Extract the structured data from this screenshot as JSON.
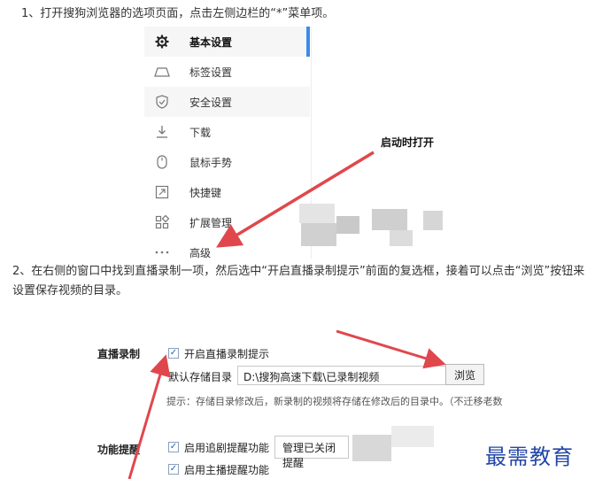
{
  "paragraphs": {
    "p1": "1、打开搜狗浏览器的选项页面，点击左侧边栏的“*”菜单项。",
    "p2": "2、在右侧的窗口中找到直播录制一项，然后选中“开启直播录制提示”前面的复选框，接着可以点击“浏览”按钮来设置保存视频的目录。"
  },
  "sidebar": {
    "items": [
      {
        "label": "基本设置",
        "icon": "gear-icon"
      },
      {
        "label": "标签设置",
        "icon": "tab-icon"
      },
      {
        "label": "安全设置",
        "icon": "shield-icon"
      },
      {
        "label": "下载",
        "icon": "download-icon"
      },
      {
        "label": "鼠标手势",
        "icon": "mouse-icon"
      },
      {
        "label": "快捷键",
        "icon": "shortcut-icon"
      },
      {
        "label": "扩展管理",
        "icon": "extensions-icon"
      },
      {
        "label": "高级",
        "icon": "more-icon"
      }
    ]
  },
  "annotation": "启动时打开",
  "settings": {
    "live_recording_label": "直播录制",
    "enable_record_prompt": "开启直播录制提示",
    "default_dir_label": "默认存储目录",
    "default_dir_value": "D:\\搜狗高速下载\\已录制视频",
    "browse_button": "浏览",
    "hint": "提示：存储目录修改后，新录制的视频将存储在修改后的目录中。（不迁移老数",
    "reminder_label": "功能提醒",
    "enable_follow_reminder": "启用追剧提醒功能",
    "manage_closed_select": "管理已关闭提醒",
    "enable_streamer_reminder": "启用主播提醒功能"
  },
  "watermark": "最需教育",
  "colors": {
    "accent": "#3b8beb",
    "arrow": "#e0474c",
    "watermark": "#2447a8"
  }
}
